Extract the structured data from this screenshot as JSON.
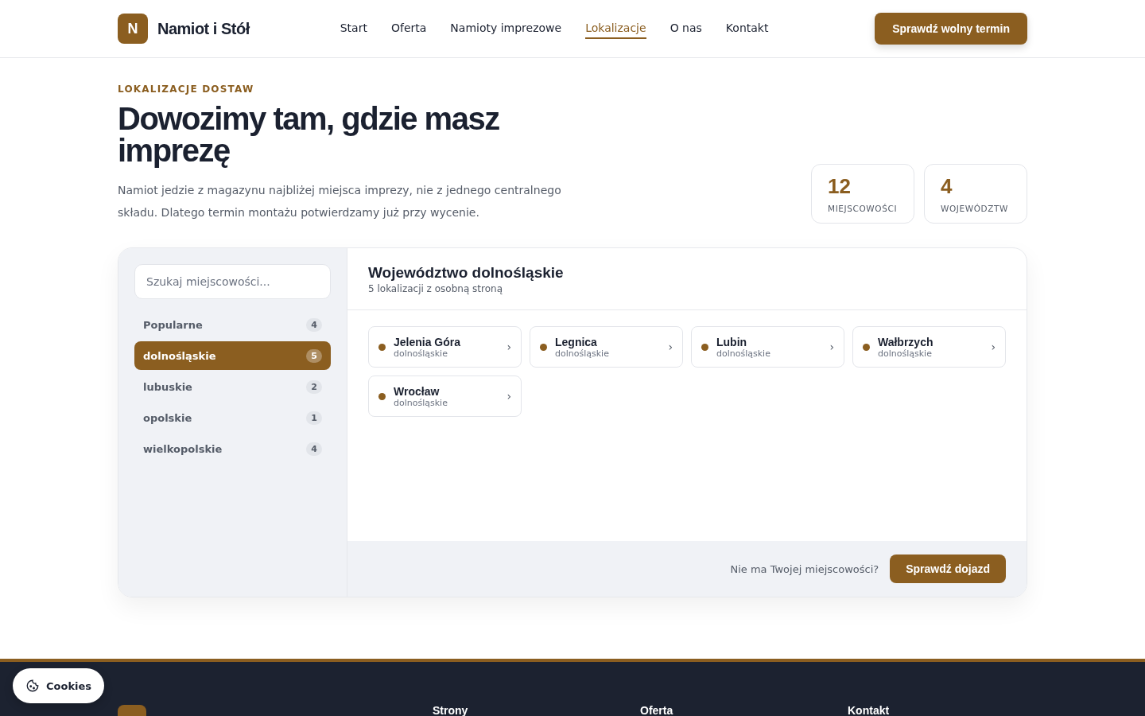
{
  "header": {
    "logo_letter": "N",
    "brand": "Namiot i Stół",
    "nav": [
      {
        "label": "Start",
        "selected": false
      },
      {
        "label": "Oferta",
        "selected": false
      },
      {
        "label": "Namioty imprezowe",
        "selected": false
      },
      {
        "label": "Lokalizacje",
        "selected": true
      },
      {
        "label": "O nas",
        "selected": false
      },
      {
        "label": "Kontakt",
        "selected": false
      }
    ],
    "cta": "Sprawdź wolny termin"
  },
  "hero": {
    "eyebrow": "LOKALIZACJE DOSTAW",
    "title": "Dowozimy tam, gdzie masz imprezę",
    "lead": "Namiot jedzie z magazynu najbliżej miejsca imprezy, nie z jednego centralnego składu. Dlatego termin montażu potwierdzamy już przy wycenie.",
    "stats": [
      {
        "value": "12",
        "label": "MIEJSCOWOŚCI"
      },
      {
        "value": "4",
        "label": "WOJEWÓDZTW"
      }
    ]
  },
  "finder": {
    "search": {
      "placeholder": "Szukaj miejscowości..."
    },
    "regions": [
      {
        "name": "Popularne",
        "count": "4",
        "selected": false
      },
      {
        "name": "dolnośląskie",
        "count": "5",
        "selected": true
      },
      {
        "name": "lubuskie",
        "count": "2",
        "selected": false
      },
      {
        "name": "opolskie",
        "count": "1",
        "selected": false
      },
      {
        "name": "wielkopolskie",
        "count": "4",
        "selected": false
      }
    ],
    "panel_title": "Województwo dolnośląskie",
    "panel_subtitle": "5 lokalizacji z osobną stroną",
    "locations": [
      {
        "name": "Jelenia Góra",
        "region": "dolnośląskie",
        "arrow": "›"
      },
      {
        "name": "Legnica",
        "region": "dolnośląskie",
        "arrow": "›"
      },
      {
        "name": "Lubin",
        "region": "dolnośląskie",
        "arrow": "›"
      },
      {
        "name": "Wałbrzych",
        "region": "dolnośląskie",
        "arrow": "›"
      },
      {
        "name": "Wrocław",
        "region": "dolnośląskie",
        "arrow": "›"
      }
    ],
    "footer_question": "Nie ma Twojej miejscowości?",
    "footer_button": "Sprawdź dojazd"
  },
  "footer": {
    "columns": [
      "Strony",
      "Oferta",
      "Kontakt"
    ]
  },
  "cookies": {
    "label": "Cookies"
  }
}
